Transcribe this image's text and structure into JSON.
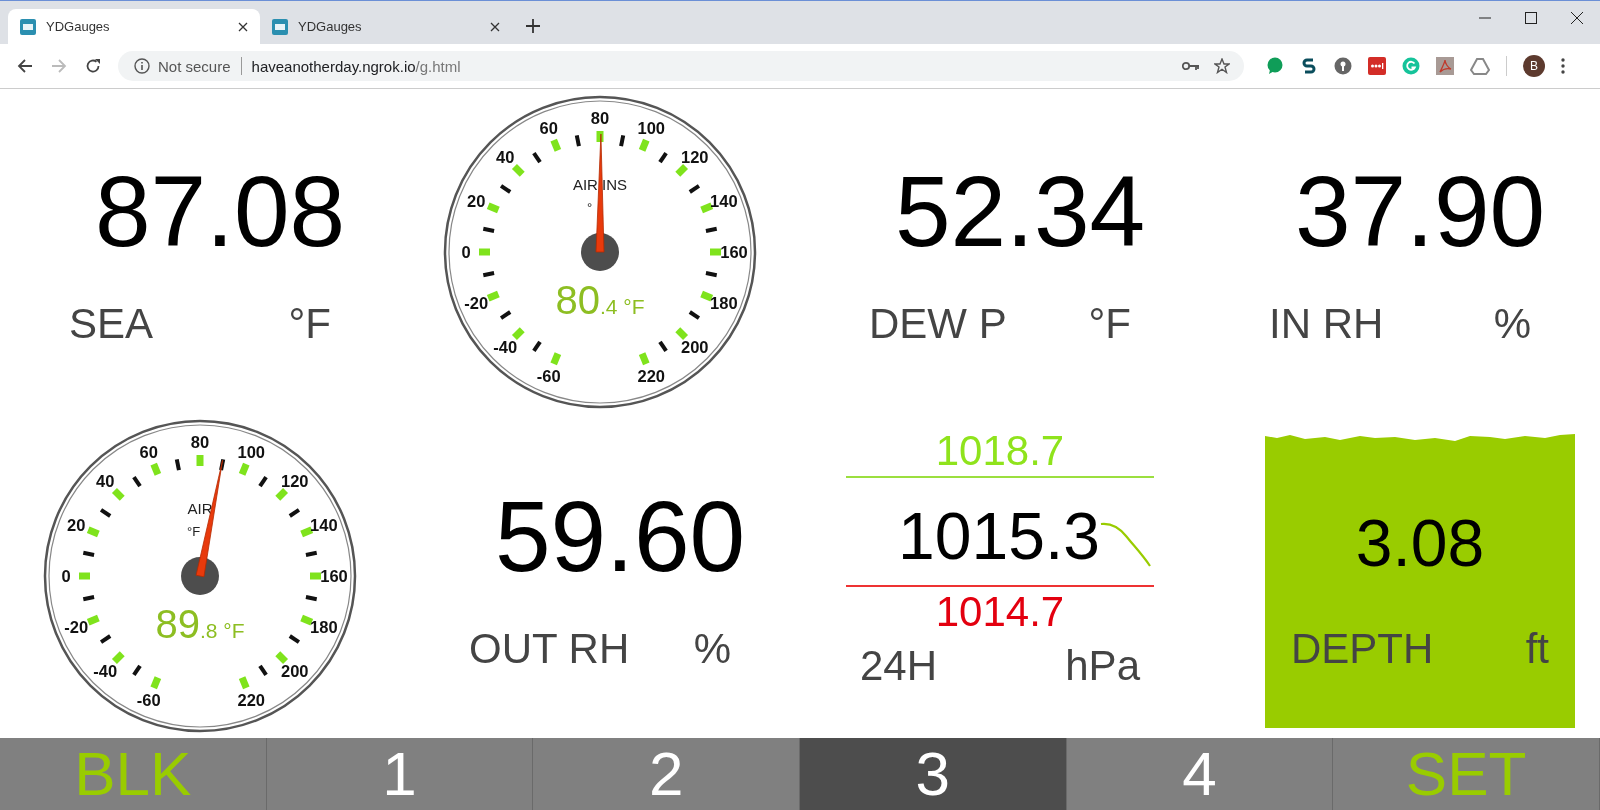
{
  "browser": {
    "tabs": [
      {
        "title": "YDGauges",
        "selected": true
      },
      {
        "title": "YDGauges",
        "selected": false
      }
    ],
    "address": {
      "security": "Not secure",
      "host": "haveanotherday.ngrok.io",
      "path": "/g.html"
    },
    "profile": "B"
  },
  "panels": [
    {
      "kind": "number",
      "value": "87.08",
      "label": "SEA",
      "unit": "°F"
    },
    {
      "kind": "gauge",
      "title": "AIR INS",
      "unit": "°",
      "value_whole": "80",
      "value_fraction": ".4 °F",
      "level": 0.5014,
      "ticks": [
        "80",
        "60",
        "100",
        "40",
        "120",
        "20",
        "140",
        "0",
        "160",
        "-20",
        "180",
        "-40",
        "200",
        "-60",
        "220"
      ]
    },
    {
      "kind": "number",
      "value": "52.34",
      "label": "DEW P",
      "unit": "°F"
    },
    {
      "kind": "number",
      "value": "37.90",
      "label": "IN RH",
      "unit": "%"
    },
    {
      "kind": "gauge",
      "title": "AIR",
      "unit": "°F",
      "value_whole": "89",
      "value_fraction": ".8 °F",
      "level": 0.535,
      "ticks": [
        "80",
        "60",
        "100",
        "40",
        "120",
        "20",
        "140",
        "0",
        "160",
        "-20",
        "180",
        "-40",
        "200",
        "-60",
        "220"
      ]
    },
    {
      "kind": "number",
      "value": "59.60",
      "label": "OUT RH",
      "unit": "%"
    },
    {
      "kind": "barometer",
      "high": "1018.7",
      "value": "1015.3",
      "low": "1014.7",
      "label": "24H",
      "unit": "hPa"
    },
    {
      "kind": "depth",
      "value": "3.08",
      "label": "DEPTH",
      "unit": "ft"
    }
  ],
  "nav": [
    {
      "label": "BLK",
      "accent": true,
      "selected": false
    },
    {
      "label": "1",
      "accent": false,
      "selected": false
    },
    {
      "label": "2",
      "accent": false,
      "selected": false
    },
    {
      "label": "3",
      "accent": false,
      "selected": true
    },
    {
      "label": "4",
      "accent": false,
      "selected": false
    },
    {
      "label": "SET",
      "accent": true,
      "selected": false
    }
  ]
}
